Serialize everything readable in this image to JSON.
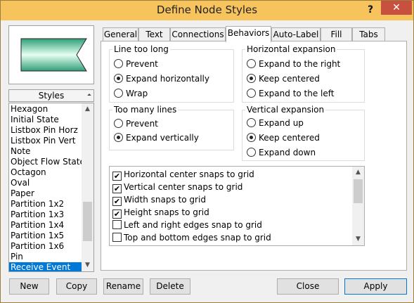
{
  "window": {
    "title": "Define Node Styles",
    "help_label": "?",
    "close_label": "✕"
  },
  "styles_panel": {
    "header_label": "Styles",
    "items": [
      "Hexagon",
      "Initial State",
      "Listbox Pin Horz",
      "Listbox Pin Vert",
      "Note",
      "Object Flow State",
      "Octagon",
      "Oval",
      "Paper",
      "Partition 1x2",
      "Partition 1x3",
      "Partition 1x4",
      "Partition 1x5",
      "Partition 1x6",
      "Pin",
      "Receive Event"
    ],
    "selected": "Receive Event"
  },
  "tabs": [
    "General",
    "Text",
    "Connections",
    "Behaviors",
    "Auto-Label",
    "Fill",
    "Tabs"
  ],
  "active_tab": "Behaviors",
  "behaviors": {
    "line_too_long": {
      "title": "Line too long",
      "options": [
        "Prevent",
        "Expand horizontally",
        "Wrap"
      ],
      "selected": "Expand horizontally"
    },
    "horizontal_expansion": {
      "title": "Horizontal expansion",
      "options": [
        "Expand to the right",
        "Keep centered",
        "Expand to the left"
      ],
      "selected": "Keep centered"
    },
    "too_many_lines": {
      "title": "Too many lines",
      "options": [
        "Prevent",
        "Expand vertically"
      ],
      "selected": "Expand vertically"
    },
    "vertical_expansion": {
      "title": "Vertical expansion",
      "options": [
        "Expand up",
        "Keep centered",
        "Expand down"
      ],
      "selected": "Keep centered"
    },
    "snap_options": [
      {
        "label": "Horizontal center snaps to grid",
        "checked": true
      },
      {
        "label": "Vertical center snaps to grid",
        "checked": true
      },
      {
        "label": "Width snaps to grid",
        "checked": true
      },
      {
        "label": "Height snaps to grid",
        "checked": true
      },
      {
        "label": "Left and right edges snap to grid",
        "checked": false
      },
      {
        "label": "Top and bottom edges snap to grid",
        "checked": false
      }
    ]
  },
  "buttons": {
    "new": "New",
    "copy": "Copy",
    "rename": "Rename",
    "delete": "Delete",
    "close": "Close",
    "apply": "Apply"
  },
  "colors": {
    "titlebar": "#f6c35c",
    "close": "#c7503e",
    "selection": "#0078d7",
    "preview_fill": "#5fc49a"
  }
}
